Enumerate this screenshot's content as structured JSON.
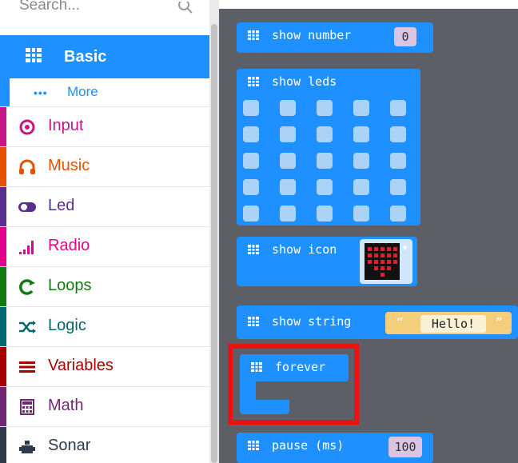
{
  "search": {
    "placeholder": "Search..."
  },
  "categories": [
    {
      "label": "Basic",
      "icon": "grid-icon",
      "color": "#1e90ff"
    },
    {
      "label": "More",
      "icon": "dots-icon",
      "color": "#1e90ff"
    },
    {
      "label": "Input",
      "icon": "target-icon",
      "color": "#c71585"
    },
    {
      "label": "Music",
      "icon": "headphones-icon",
      "color": "#e65100"
    },
    {
      "label": "Led",
      "icon": "toggle-icon",
      "color": "#5c2d91"
    },
    {
      "label": "Radio",
      "icon": "signal-bars-icon",
      "color": "#e3008c"
    },
    {
      "label": "Loops",
      "icon": "loop-arrow-icon",
      "color": "#107c10"
    },
    {
      "label": "Logic",
      "icon": "shuffle-icon",
      "color": "#006970"
    },
    {
      "label": "Variables",
      "icon": "list-icon",
      "color": "#a80000"
    },
    {
      "label": "Math",
      "icon": "calculator-icon",
      "color": "#712672"
    },
    {
      "label": "Sonar",
      "icon": "robot-icon",
      "color": "#2f3b4a"
    }
  ],
  "blocks": {
    "show_number": {
      "label": "show number",
      "value": "0"
    },
    "show_leds": {
      "label": "show leds"
    },
    "show_icon": {
      "label": "show icon"
    },
    "show_string": {
      "label": "show string",
      "value": "Hello!"
    },
    "forever": {
      "label": "forever"
    },
    "pause": {
      "label": "pause (ms)",
      "value": "100"
    }
  },
  "colors": {
    "block": "#1e90ff",
    "workspace": "#5c6066",
    "highlight": "#ee1111"
  }
}
